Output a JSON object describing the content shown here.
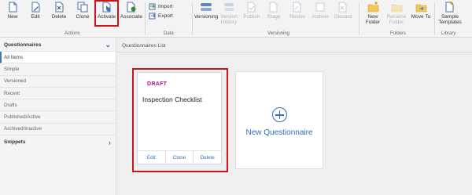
{
  "ribbon": {
    "actions": {
      "new": "New",
      "edit": "Edit",
      "delete": "Delete",
      "clone": "Clone",
      "activate": "Activate",
      "associate": "Associate",
      "group_label": "Actions"
    },
    "data": {
      "import": "Import",
      "export": "Export",
      "group_label": "Data"
    },
    "versioning": {
      "versioning": "Versioning",
      "version_history_1": "Version",
      "version_history_2": "History",
      "publish": "Publish",
      "stage": "Stage",
      "revise": "Revise",
      "archive": "Archive",
      "discard": "Discard",
      "group_label": "Versioning"
    },
    "folders": {
      "new_folder_1": "New",
      "new_folder_2": "Folder",
      "rename_folder_1": "Rename",
      "rename_folder_2": "Folder",
      "move_to": "Move To",
      "group_label": "Folders"
    },
    "library": {
      "sample_templates_1": "Sample",
      "sample_templates_2": "Templates",
      "group_label": "Library"
    }
  },
  "sidebar": {
    "header": "Questionnaires",
    "items": [
      "All Items",
      "Simple",
      "Versioned",
      "Recent",
      "Drafts",
      "Published/Active",
      "Archived/Inactive"
    ],
    "snippets": "Snippets"
  },
  "main": {
    "title": "Questionnaires List",
    "card": {
      "status": "DRAFT",
      "name": "Inspection Checklist",
      "actions": [
        "Edit",
        "Clone",
        "Delete"
      ]
    },
    "new_card_label": "New Questionnaire"
  },
  "colors": {
    "accent": "#2e6fb8",
    "draft": "#b0138e",
    "highlight": "#d1101d"
  }
}
